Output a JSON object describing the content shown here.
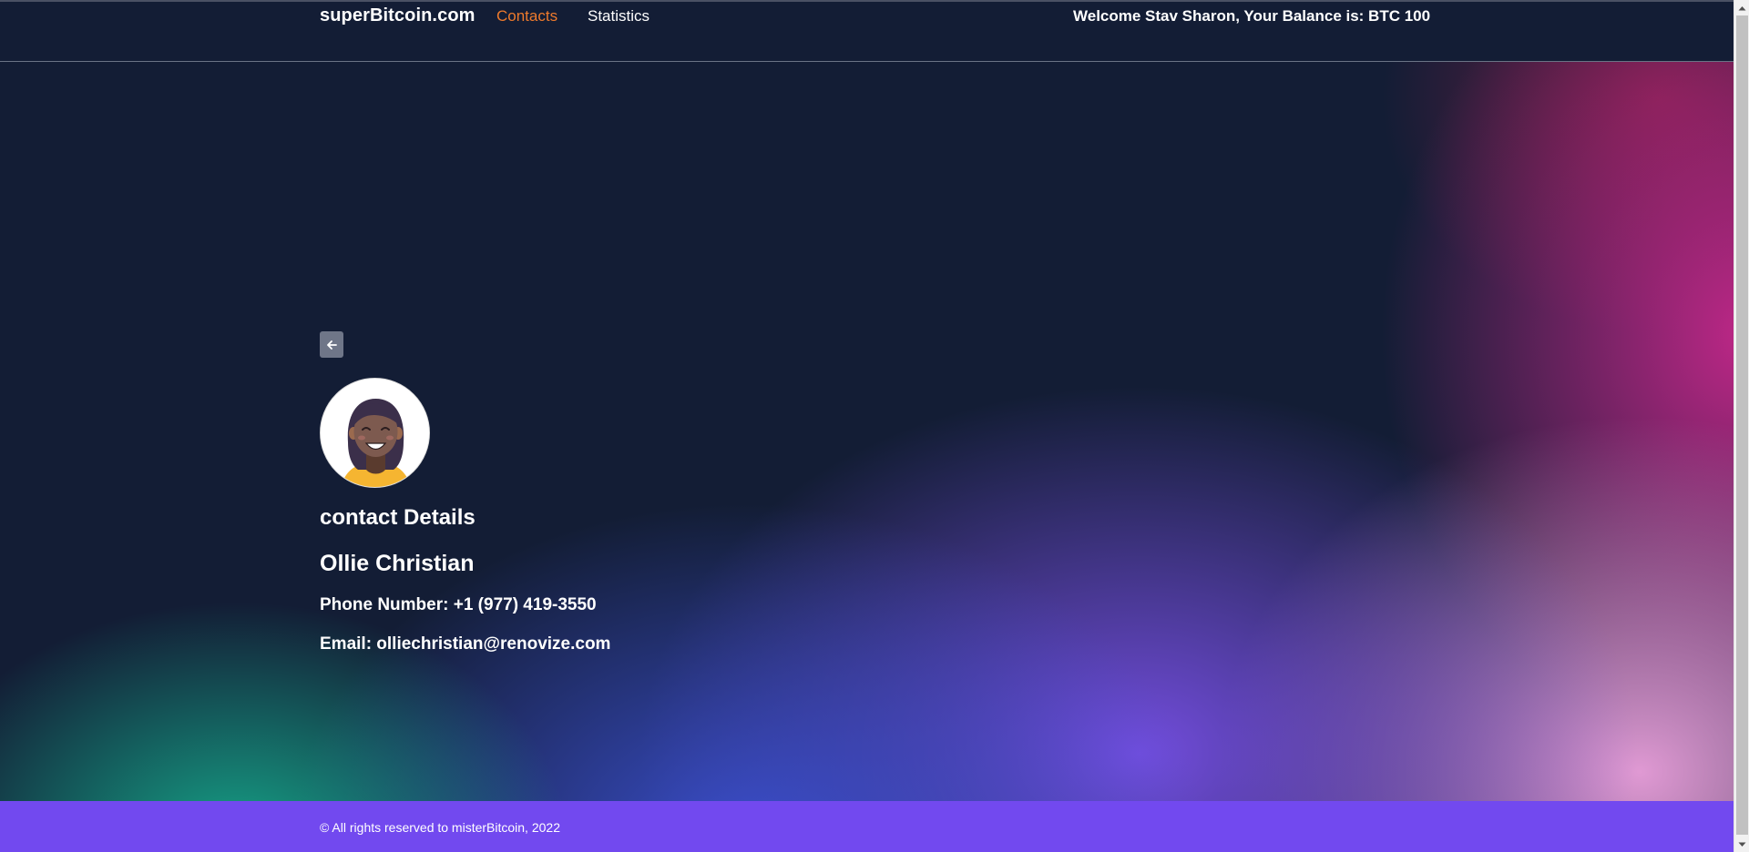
{
  "header": {
    "brand": "superBitcoin.com",
    "nav": {
      "contacts": "Contacts",
      "statistics": "Statistics"
    },
    "welcome": "Welcome Stav Sharon, Your Balance is: BTC 100"
  },
  "contact": {
    "section_title": "contact Details",
    "name": "Ollie Christian",
    "phone_line": "Phone Number: +1 (977) 419-3550",
    "email_line": "Email: olliechristian@renovize.com",
    "avatar_icon": "person-avatar-icon",
    "back_icon": "arrow-left-icon"
  },
  "footer": {
    "text": "© All rights reserved to misterBitcoin, 2022"
  },
  "colors": {
    "header_bg": "#131d35",
    "nav_active": "#ee7a2c",
    "footer_bg": "#7249ef",
    "back_button_bg": "#6f7688"
  }
}
